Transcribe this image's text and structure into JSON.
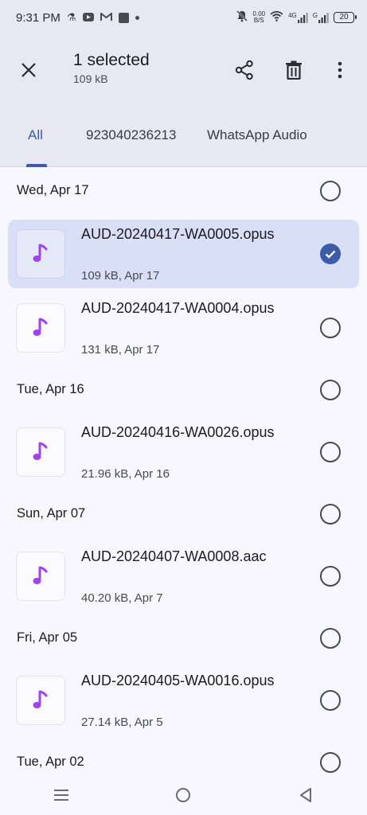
{
  "status_bar": {
    "time": "9:31 PM",
    "net_speed_value": "0.00",
    "net_speed_unit": "B/S",
    "sim1_label": "4G",
    "sim2_label": "G",
    "battery": "20"
  },
  "app_bar": {
    "title": "1 selected",
    "subtitle": "109 kB"
  },
  "tabs": [
    "All",
    "923040236213",
    "WhatsApp Audio"
  ],
  "sections": [
    {
      "date": "Wed, Apr 17",
      "files": [
        {
          "name": "AUD-20240417-WA0005.opus",
          "meta": "109 kB, Apr 17",
          "selected": true
        },
        {
          "name": "AUD-20240417-WA0004.opus",
          "meta": "131 kB, Apr 17",
          "selected": false
        }
      ]
    },
    {
      "date": "Tue, Apr 16",
      "files": [
        {
          "name": "AUD-20240416-WA0026.opus",
          "meta": "21.96 kB, Apr 16",
          "selected": false
        }
      ]
    },
    {
      "date": "Sun, Apr 07",
      "files": [
        {
          "name": "AUD-20240407-WA0008.aac",
          "meta": "40.20 kB, Apr 7",
          "selected": false
        }
      ]
    },
    {
      "date": "Fri, Apr 05",
      "files": [
        {
          "name": "AUD-20240405-WA0016.opus",
          "meta": "27.14 kB, Apr 5",
          "selected": false
        }
      ]
    },
    {
      "date": "Tue, Apr 02",
      "files": []
    }
  ],
  "colors": {
    "accent": "#3d5ba9",
    "music_icon": "#a142f4",
    "selected_bg": "#d8dff6"
  }
}
